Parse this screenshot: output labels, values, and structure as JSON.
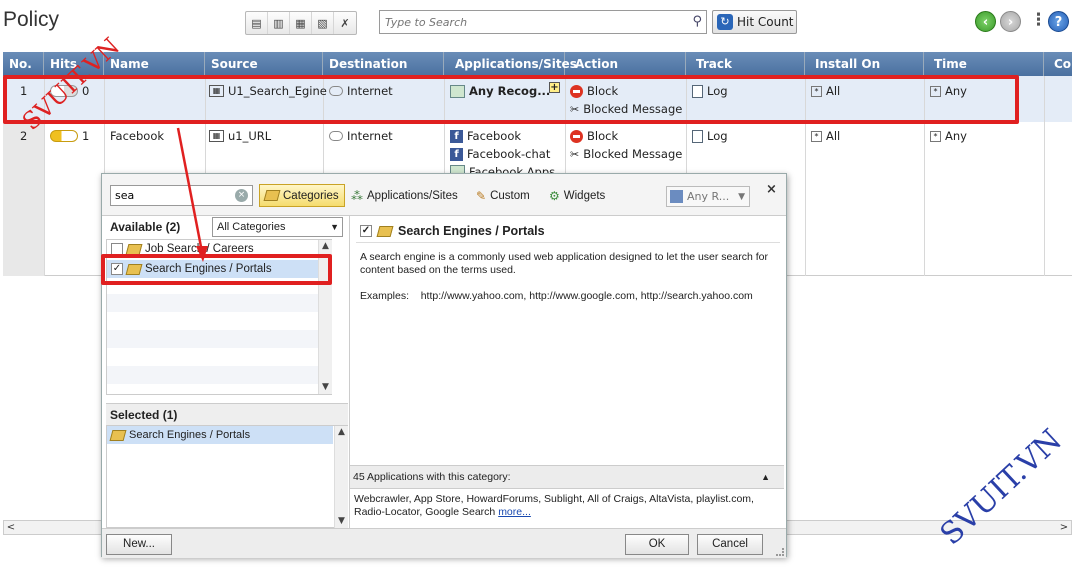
{
  "header": {
    "title": "Policy",
    "search_placeholder": "Type to Search",
    "hit_count_label": "Hit Count"
  },
  "columns": [
    "No.",
    "Hits",
    "Name",
    "Source",
    "Destination",
    "Applications/Sites",
    "Action",
    "Track",
    "Install On",
    "Time",
    "Co"
  ],
  "rows": [
    {
      "no": "1",
      "hits": "0",
      "name": "",
      "source": "U1_Search_Egine",
      "destination": "Internet",
      "apps": [
        "Any Recog..."
      ],
      "action": [
        "Block",
        "Blocked Message"
      ],
      "track": "Log",
      "install_on": "All",
      "time": "Any"
    },
    {
      "no": "2",
      "hits": "1",
      "name": "Facebook",
      "source": "u1_URL",
      "destination": "Internet",
      "apps": [
        "Facebook",
        "Facebook-chat",
        "Facebook Apps"
      ],
      "action": [
        "Block",
        "Blocked Message"
      ],
      "track": "Log",
      "install_on": "All",
      "time": "Any"
    }
  ],
  "popup": {
    "search_value": "sea",
    "tabs": {
      "categories": "Categories",
      "apps_sites": "Applications/Sites",
      "custom": "Custom",
      "widgets": "Widgets"
    },
    "any_r": "Any R...",
    "available_label": "Available (2)",
    "filter_value": "All Categories",
    "available_items": [
      {
        "label": "Job Search / Careers",
        "checked": false
      },
      {
        "label": "Search Engines / Portals",
        "checked": true
      }
    ],
    "selected_label": "Selected (1)",
    "selected_items": [
      "Search Engines / Portals"
    ],
    "detail": {
      "title": "Search Engines / Portals",
      "description": "A search engine is a commonly used web application designed to let the user search for content based on the terms used.",
      "examples_label": "Examples:",
      "examples": "http://www.yahoo.com, http://www.google.com, http://search.yahoo.com",
      "count_text": "45 Applications with this category:",
      "apps_text": "Webcrawler, App Store, HowardForums, Sublight, All of Craigs, AltaVista, playlist.com, Radio-Locator, Google Search",
      "more_label": "more..."
    },
    "buttons": {
      "new": "New...",
      "ok": "OK",
      "cancel": "Cancel"
    }
  },
  "watermarks": [
    "SVUIT.VN",
    "SVUIT.VN"
  ],
  "colors": {
    "header_bg": "#5a7fb0",
    "highlight_red": "#e02020",
    "row_selected": "#e4ecf7",
    "tab_active": "#f5dc6e"
  }
}
